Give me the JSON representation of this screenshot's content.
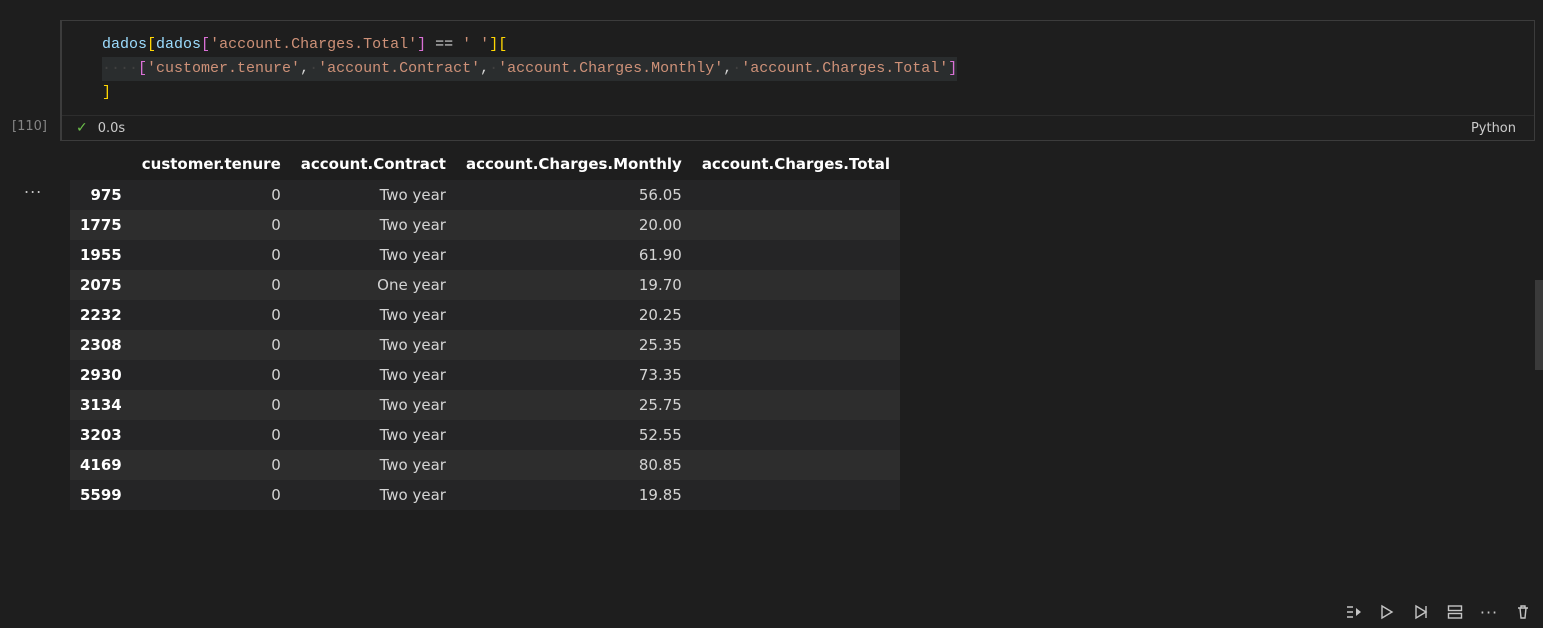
{
  "cell": {
    "exec_count": "[110]",
    "status_time": "0.0s",
    "language": "Python",
    "code": {
      "var": "dados",
      "col_filter": "'account.Charges.Total'",
      "op": "==",
      "val": "' '",
      "sel_cols": [
        "'customer.tenure'",
        "'account.Contract'",
        "'account.Charges.Monthly'",
        "'account.Charges.Total'"
      ]
    }
  },
  "table": {
    "columns": [
      "customer.tenure",
      "account.Contract",
      "account.Charges.Monthly",
      "account.Charges.Total"
    ],
    "rows": [
      {
        "idx": "975",
        "tenure": "0",
        "contract": "Two year",
        "monthly": "56.05",
        "total": ""
      },
      {
        "idx": "1775",
        "tenure": "0",
        "contract": "Two year",
        "monthly": "20.00",
        "total": ""
      },
      {
        "idx": "1955",
        "tenure": "0",
        "contract": "Two year",
        "monthly": "61.90",
        "total": ""
      },
      {
        "idx": "2075",
        "tenure": "0",
        "contract": "One year",
        "monthly": "19.70",
        "total": ""
      },
      {
        "idx": "2232",
        "tenure": "0",
        "contract": "Two year",
        "monthly": "20.25",
        "total": ""
      },
      {
        "idx": "2308",
        "tenure": "0",
        "contract": "Two year",
        "monthly": "25.35",
        "total": ""
      },
      {
        "idx": "2930",
        "tenure": "0",
        "contract": "Two year",
        "monthly": "73.35",
        "total": ""
      },
      {
        "idx": "3134",
        "tenure": "0",
        "contract": "Two year",
        "monthly": "25.75",
        "total": ""
      },
      {
        "idx": "3203",
        "tenure": "0",
        "contract": "Two year",
        "monthly": "52.55",
        "total": ""
      },
      {
        "idx": "4169",
        "tenure": "0",
        "contract": "Two year",
        "monthly": "80.85",
        "total": ""
      },
      {
        "idx": "5599",
        "tenure": "0",
        "contract": "Two year",
        "monthly": "19.85",
        "total": ""
      }
    ]
  },
  "toolbar": {
    "ellipsis": "..."
  }
}
